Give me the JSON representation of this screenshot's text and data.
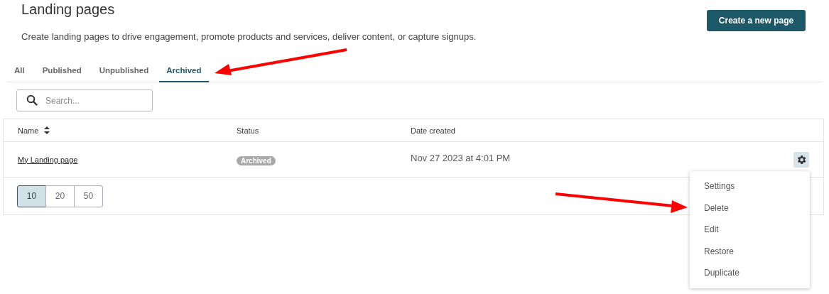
{
  "header": {
    "title": "Landing pages",
    "description": "Create landing pages to drive engagement, promote products and services, deliver content, or capture signups.",
    "create_button": "Create a new page"
  },
  "tabs": [
    {
      "label": "All",
      "selected": false
    },
    {
      "label": "Published",
      "selected": false
    },
    {
      "label": "Unpublished",
      "selected": false
    },
    {
      "label": "Archived",
      "selected": true
    }
  ],
  "search": {
    "placeholder": "Search..."
  },
  "table": {
    "columns": [
      "Name",
      "Status",
      "Date created"
    ],
    "rows": [
      {
        "name": "My Landing page",
        "status": "Archived",
        "date_created": "Nov 27 2023 at 4:01 PM"
      }
    ]
  },
  "page_sizes": [
    {
      "label": "10",
      "selected": true
    },
    {
      "label": "20",
      "selected": false
    },
    {
      "label": "50",
      "selected": false
    }
  ],
  "actions_menu": {
    "items": [
      "Settings",
      "Delete",
      "Edit",
      "Restore",
      "Duplicate"
    ]
  }
}
